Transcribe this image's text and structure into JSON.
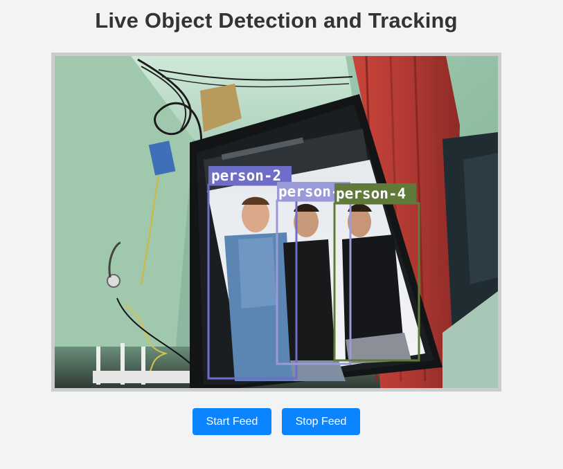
{
  "page": {
    "title": "Live Object Detection and Tracking"
  },
  "controls": {
    "start_label": "Start Feed",
    "stop_label": "Stop Feed"
  },
  "detections": [
    {
      "label": "person-2",
      "color": "#6e6ec8"
    },
    {
      "label": "person-3",
      "color": "#9a9ad8"
    },
    {
      "label": "person-4",
      "color": "#5f7a3a"
    }
  ],
  "colors": {
    "button": "#0b84ff",
    "frame_border": "#cccccc",
    "background": "#f2f3f5"
  }
}
